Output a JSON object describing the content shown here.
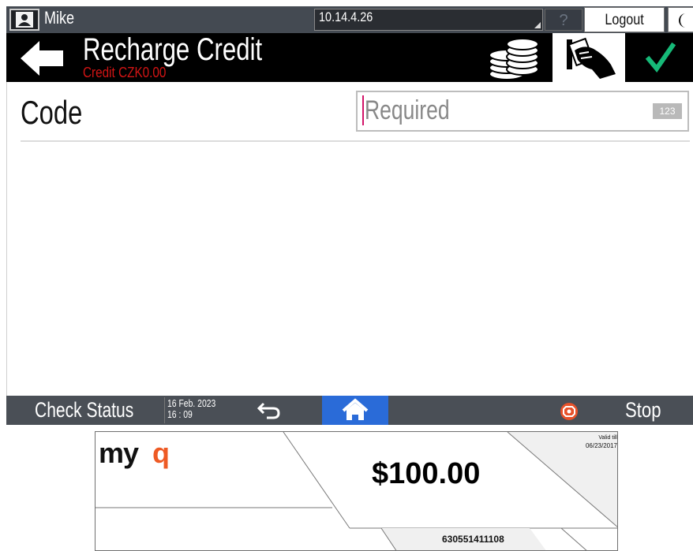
{
  "status_bar": {
    "user_name": "Mike",
    "ip_address": "10.14.4.26",
    "help_label": "?",
    "logout_label": "Logout",
    "night_mode_icon": "moon-icon"
  },
  "header": {
    "title": "Recharge Credit",
    "credit_text": "Credit CZK0.00",
    "back_icon": "back-arrow-icon",
    "options": [
      {
        "name": "coins",
        "icon": "coins-icon",
        "selected": false
      },
      {
        "name": "card",
        "icon": "card-insert-icon",
        "selected": true
      }
    ],
    "confirm_icon": "checkmark-icon"
  },
  "form": {
    "code_label": "Code",
    "code_value": "",
    "code_placeholder": "Required",
    "keyboard_badge": "123"
  },
  "bottom_bar": {
    "check_status_label": "Check Status",
    "date": "16 Feb. 2023",
    "time": "16 : 09",
    "back_icon": "return-icon",
    "home_icon": "home-icon",
    "stop_icon": "stop-icon",
    "stop_label": "Stop"
  },
  "voucher": {
    "brand": "myQ",
    "amount": "$100.00",
    "valid_label": "Valid till",
    "valid_date": "06/23/2017",
    "serial": "630551411108"
  },
  "colors": {
    "accent_red": "#d21414",
    "home_blue": "#2a6bd8",
    "confirm_green": "#16b978",
    "stop_orange": "#e8522a",
    "logo_orange": "#ee5a24"
  }
}
